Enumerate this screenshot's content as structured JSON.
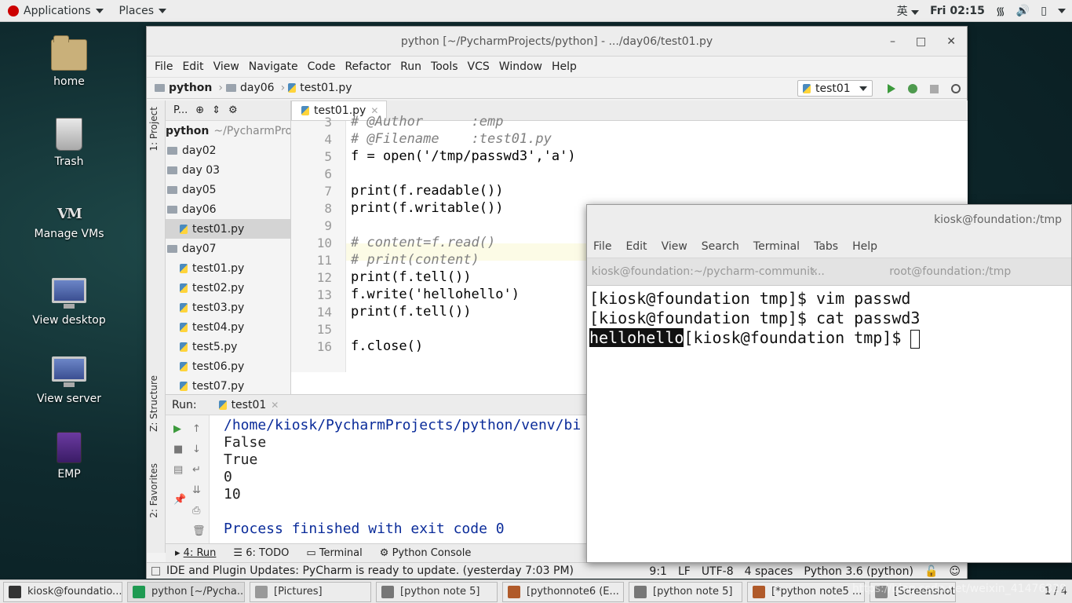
{
  "topbar": {
    "applications": "Applications",
    "places": "Places",
    "input_method": "英",
    "clock": "Fri 02:15"
  },
  "desktop": {
    "icons": [
      {
        "label": "home"
      },
      {
        "label": "Trash"
      },
      {
        "label": "Manage VMs"
      },
      {
        "label": "View desktop"
      },
      {
        "label": "View server"
      },
      {
        "label": "EMP"
      }
    ]
  },
  "pycharm": {
    "title": "python [~/PycharmProjects/python] - .../day06/test01.py",
    "menu": [
      "File",
      "Edit",
      "View",
      "Navigate",
      "Code",
      "Refactor",
      "Run",
      "Tools",
      "VCS",
      "Window",
      "Help"
    ],
    "breadcrumb": [
      "python",
      "day06",
      "test01.py"
    ],
    "run_config": "test01",
    "side_tabs": {
      "project": "1: Project",
      "structure": "Z: Structure",
      "favorites": "2: Favorites"
    },
    "project": {
      "header": "P...",
      "root": "python",
      "root_path": "~/PycharmProjec",
      "items": [
        {
          "label": "day02",
          "type": "dir"
        },
        {
          "label": "day 03",
          "type": "dir"
        },
        {
          "label": "day05",
          "type": "dir"
        },
        {
          "label": "day06",
          "type": "dir"
        },
        {
          "label": "test01.py",
          "type": "file",
          "selected": true
        },
        {
          "label": "day07",
          "type": "dir"
        },
        {
          "label": "test01.py",
          "type": "file"
        },
        {
          "label": "test02.py",
          "type": "file"
        },
        {
          "label": "test03.py",
          "type": "file"
        },
        {
          "label": "test04.py",
          "type": "file"
        },
        {
          "label": "test5.py",
          "type": "file"
        },
        {
          "label": "test06.py",
          "type": "file"
        },
        {
          "label": "test07.py",
          "type": "file"
        }
      ]
    },
    "editor": {
      "tab": "test01.py",
      "lines": [
        {
          "n": "3",
          "text": "# @Author      :emp"
        },
        {
          "n": "4",
          "text": "# @Filename    :test01.py"
        },
        {
          "n": "5",
          "text": "f = open('/tmp/passwd3','a')"
        },
        {
          "n": "6",
          "text": ""
        },
        {
          "n": "7",
          "text": "print(f.readable())"
        },
        {
          "n": "8",
          "text": "print(f.writable())"
        },
        {
          "n": "9",
          "text": ""
        },
        {
          "n": "10",
          "text": "# content=f.read()"
        },
        {
          "n": "11",
          "text": "# print(content)"
        },
        {
          "n": "12",
          "text": "print(f.tell())"
        },
        {
          "n": "13",
          "text": "f.write('hellohello')"
        },
        {
          "n": "14",
          "text": "print(f.tell())"
        },
        {
          "n": "15",
          "text": ""
        },
        {
          "n": "16",
          "text": "f.close()"
        }
      ]
    },
    "run": {
      "label": "Run:",
      "tab": "test01",
      "output": [
        "/home/kiosk/PycharmProjects/python/venv/bi",
        "False",
        "True",
        "0",
        "10",
        "",
        "Process finished with exit code 0"
      ]
    },
    "bottom_tabs": [
      "4: Run",
      "6: TODO",
      "Terminal",
      "Python Console"
    ],
    "status": {
      "message": "IDE and Plugin Updates: PyCharm is ready to update. (yesterday 7:03 PM)",
      "position": "9:1",
      "line_sep": "LF",
      "encoding": "UTF-8",
      "indent": "4 spaces",
      "interpreter": "Python 3.6 (python)"
    }
  },
  "terminal": {
    "title": "kiosk@foundation:/tmp",
    "menu": [
      "File",
      "Edit",
      "View",
      "Search",
      "Terminal",
      "Tabs",
      "Help"
    ],
    "tabs": [
      "kiosk@foundation:~/pycharm-communit...",
      "root@foundation:/tmp"
    ],
    "lines": [
      "[kiosk@foundation tmp]$ vim passwd",
      "[kiosk@foundation tmp]$ cat passwd3"
    ],
    "highlighted": "hellohello",
    "prompt": "[kiosk@foundation tmp]$ "
  },
  "taskbar": {
    "tasks": [
      {
        "label": "kiosk@foundatio...",
        "active": false
      },
      {
        "label": "python [~/Pycha...",
        "active": true
      },
      {
        "label": "[Pictures]",
        "active": false
      },
      {
        "label": "[python note 5]",
        "active": false
      },
      {
        "label": "[pythonnote6 (E...",
        "active": false
      },
      {
        "label": "[python note 5]",
        "active": false
      },
      {
        "label": "[*python note5 ...",
        "active": false
      },
      {
        "label": "[Screenshot fro...",
        "active": false
      }
    ],
    "pager": "1 / 4"
  },
  "watermark": "https://blog.csdn.net/weixin_41476329"
}
